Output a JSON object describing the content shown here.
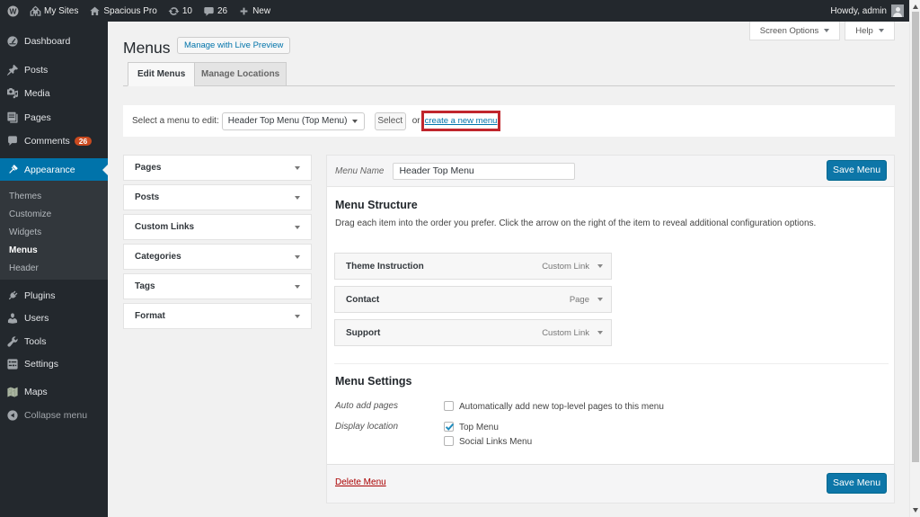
{
  "admin_bar": {
    "my_sites": "My Sites",
    "site_name": "Spacious Pro",
    "updates_count": "10",
    "comments_count": "26",
    "new_label": "New",
    "howdy": "Howdy, admin"
  },
  "sidebar": {
    "items": [
      {
        "label": "Dashboard"
      },
      {
        "label": "Posts"
      },
      {
        "label": "Media"
      },
      {
        "label": "Pages"
      },
      {
        "label": "Comments",
        "badge": "26"
      },
      {
        "label": "Appearance"
      },
      {
        "label": "Plugins"
      },
      {
        "label": "Users"
      },
      {
        "label": "Tools"
      },
      {
        "label": "Settings"
      },
      {
        "label": "Maps"
      },
      {
        "label": "Collapse menu"
      }
    ],
    "appearance_submenu": [
      {
        "label": "Themes"
      },
      {
        "label": "Customize"
      },
      {
        "label": "Widgets"
      },
      {
        "label": "Menus",
        "current": true
      },
      {
        "label": "Header"
      }
    ]
  },
  "header": {
    "page_title": "Menus",
    "manage_live_preview": "Manage with Live Preview",
    "screen_options": "Screen Options",
    "help": "Help"
  },
  "tabs": {
    "edit_menus": "Edit Menus",
    "manage_locations": "Manage Locations"
  },
  "menu_select": {
    "label": "Select a menu to edit:",
    "selected_value": "Header Top Menu (Top Menu)",
    "select_button": "Select",
    "or_text": "or",
    "create_link": "create a new menu"
  },
  "accordion": {
    "sections": [
      {
        "label": "Pages"
      },
      {
        "label": "Posts"
      },
      {
        "label": "Custom Links"
      },
      {
        "label": "Categories"
      },
      {
        "label": "Tags"
      },
      {
        "label": "Format"
      }
    ]
  },
  "editor": {
    "menu_name_label": "Menu Name",
    "menu_name_value": "Header Top Menu",
    "save_button": "Save Menu",
    "structure_title": "Menu Structure",
    "structure_help": "Drag each item into the order you prefer. Click the arrow on the right of the item to reveal additional configuration options.",
    "items": [
      {
        "label": "Theme Instruction",
        "type": "Custom Link"
      },
      {
        "label": "Contact",
        "type": "Page"
      },
      {
        "label": "Support",
        "type": "Custom Link"
      }
    ],
    "settings_title": "Menu Settings",
    "auto_add_label": "Auto add pages",
    "auto_add_option": "Automatically add new top-level pages to this menu",
    "display_location_label": "Display location",
    "locations": [
      {
        "label": "Top Menu",
        "checked": true
      },
      {
        "label": "Social Links Menu",
        "checked": false
      }
    ],
    "delete_link": "Delete Menu",
    "save_button_footer": "Save Menu"
  },
  "colors": {
    "accent_blue": "#0073aa",
    "button_blue": "#0d76a8",
    "annotation_red": "#c0262d",
    "admin_dark": "#23282d",
    "badge_orange": "#ca4a1f"
  }
}
